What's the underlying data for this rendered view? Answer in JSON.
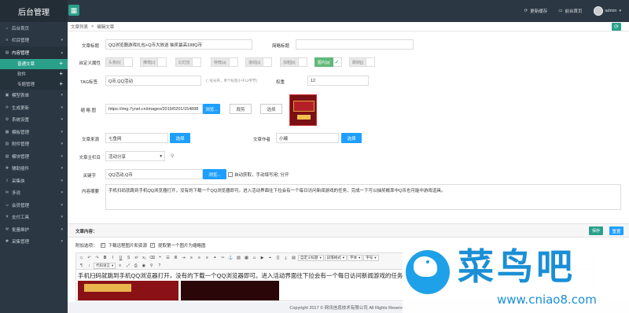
{
  "header": {
    "brand": "后台管理",
    "menu_icon": "grid-icon",
    "clear_cache": "更新缓存",
    "front_page": "前台首页",
    "user": "admin"
  },
  "sidebar": {
    "items": [
      {
        "label": "后台首页",
        "icon": "home-icon"
      },
      {
        "label": "栏目管理",
        "icon": "list-icon"
      },
      {
        "label": "内容管理",
        "icon": "doc-icon"
      },
      {
        "label": "模型表单",
        "icon": "form-icon"
      },
      {
        "label": "生成更新",
        "icon": "refresh-icon"
      },
      {
        "label": "系统设置",
        "icon": "gear-icon"
      },
      {
        "label": "模板管理",
        "icon": "template-icon"
      },
      {
        "label": "附件管理",
        "icon": "attach-icon"
      },
      {
        "label": "模块管理",
        "icon": "module-icon"
      },
      {
        "label": "辅助插件",
        "icon": "plugin-icon"
      },
      {
        "label": "采集侠",
        "icon": "collect-icon"
      },
      {
        "label": "多说",
        "icon": "comment-icon"
      },
      {
        "label": "会员管理",
        "icon": "user-icon"
      },
      {
        "label": "支付工具",
        "icon": "pay-icon"
      },
      {
        "label": "批量维护",
        "icon": "batch-icon"
      },
      {
        "label": "采集管理",
        "icon": "spider-icon"
      }
    ],
    "sub_items": [
      "普通文章",
      "软件",
      "专题管理"
    ]
  },
  "breadcrumb": {
    "a": "文章列表",
    "sep": ">",
    "b": "编辑文章"
  },
  "form": {
    "title_label": "文章标题",
    "title_value": "QQ浏览器游戏礼包+Q币大放送 抽奖最高188Q币",
    "short_title_label": "简略标题",
    "short_title_value": "",
    "attr_label": "自定义属性",
    "attrs": [
      {
        "label": "头条[h]",
        "on": false
      },
      {
        "label": "推荐[c]",
        "on": false
      },
      {
        "label": "幻灯[f]",
        "on": false
      },
      {
        "label": "特荐[a]",
        "on": false
      },
      {
        "label": "滚动[s]",
        "on": false
      },
      {
        "label": "加粗[b]",
        "on": false
      },
      {
        "label": "图片[p]",
        "on": true
      },
      {
        "label": "跳转[j]",
        "on": false
      }
    ],
    "tag_label": "TAG标签",
    "tag_value": "Q币,QQ活动",
    "tag_hint": "(','号分开，单个标签小于12字节)",
    "weight_label": "权重",
    "weight_value": "12",
    "thumb_label": "缩 略 图",
    "thumb_value": "https://img.7ynet.cn/images/2019/0201/154898",
    "browse": "浏览...",
    "crop": "裁剪",
    "select": "选择",
    "source_label": "文章来源",
    "source_value": "七鱼网",
    "author_label": "文章作者",
    "author_value": "小编",
    "column_label": "文章主栏目",
    "column_value": "活动分享",
    "keywords_label": "关键字",
    "keywords_value": "QQ活动,Q币",
    "auto_get": "自动获取，手动填写用','分开",
    "summary_label": "内容摘要",
    "summary_value": "手机扫码就跳到手机QQ浏览器打开，没有的下载一个QQ浏览器即可。进入活动界面往下拉会有一个每日访问新闻游戏的任务，完成一下可以抽奖概率中Q币也可能中游戏道具。"
  },
  "content": {
    "title": "文章内容：",
    "save": "保存",
    "reset": "重置",
    "options_label": "附加选项：",
    "opt1": "下载远程图片和资源",
    "opt2": "提取第一个图片为缩略图",
    "toolbar": {
      "html": "HTML",
      "source": "代码语言",
      "para": "段落格式",
      "font": "字体",
      "size": "字号",
      "custom": "自定义标题"
    },
    "editor_text": "手机扫码就跳到手机QQ浏览器打开，没有的下载一个QQ浏览器即可。进入活动界面往下拉会有一个每日访问新闻游戏的任务，完成一下可"
  },
  "footer": {
    "text": "Copyright 2017 © 网讯信息技术有限公司 All Rights Reserved"
  },
  "watermark": {
    "zh": "菜鸟吧",
    "url": "www.cniao8.com"
  },
  "colors": {
    "accent": "#2aa08a",
    "sidebar": "#2b3844",
    "button": "#1e9fff"
  }
}
